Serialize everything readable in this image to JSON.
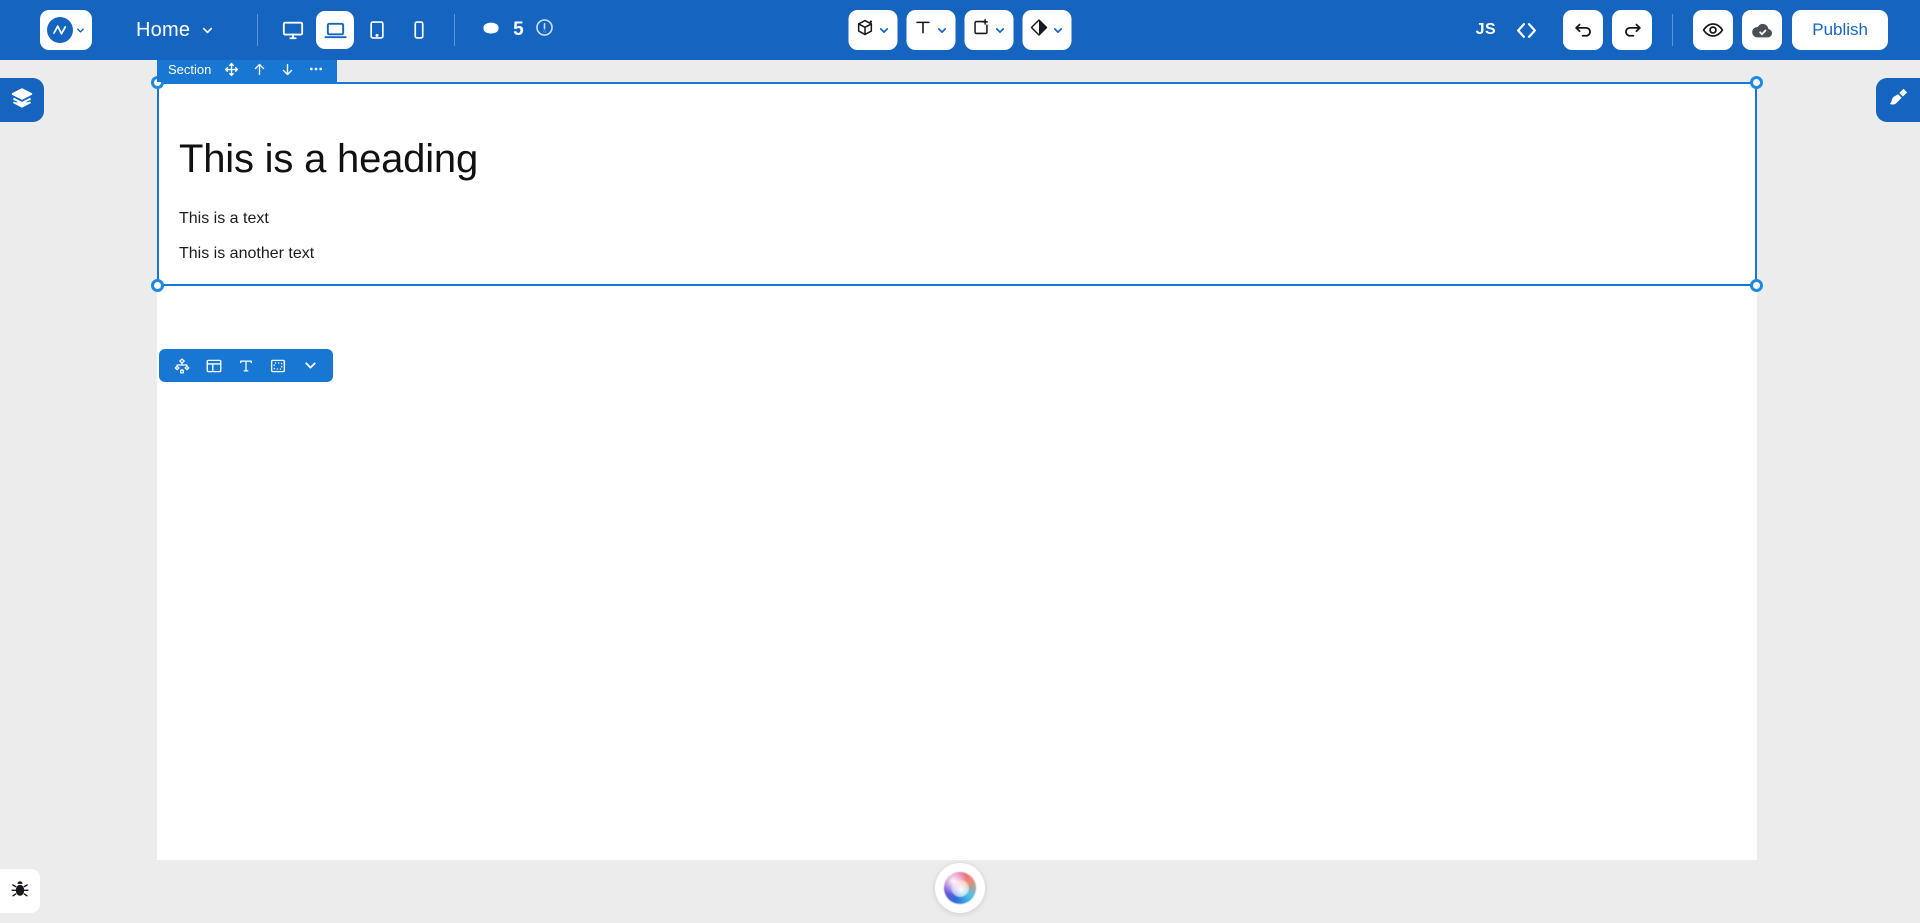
{
  "topbar": {
    "logo_name": "brand-logo",
    "page_selector": {
      "label": "Home"
    },
    "devices": [
      {
        "name": "desktop",
        "active": false
      },
      {
        "name": "laptop",
        "active": true
      },
      {
        "name": "tablet",
        "active": false
      },
      {
        "name": "mobile",
        "active": false
      }
    ],
    "credits": {
      "value": "5"
    },
    "tools": [
      {
        "name": "add-element",
        "icon": "cube-plus-icon"
      },
      {
        "name": "text",
        "icon": "text-t-icon"
      },
      {
        "name": "add-block",
        "icon": "square-plus-icon"
      },
      {
        "name": "theme",
        "icon": "contrast-diamond-icon"
      }
    ],
    "js_label": "JS",
    "code_label": "<>",
    "undo_label": "Undo",
    "redo_label": "Redo",
    "preview_label": "Preview",
    "save_label": "Saved",
    "publish_label": "Publish"
  },
  "side": {
    "left_tab": "Layers",
    "right_tab": "Design",
    "bug_tab": "Report a bug"
  },
  "selection": {
    "tag_label": "Section",
    "actions": [
      {
        "name": "move",
        "icon": "move-arrows-icon"
      },
      {
        "name": "move-up",
        "icon": "arrow-up-icon"
      },
      {
        "name": "move-down",
        "icon": "arrow-down-icon"
      },
      {
        "name": "more",
        "icon": "ellipsis-icon"
      }
    ],
    "element_tools": [
      {
        "name": "structure",
        "icon": "sitemap-icon"
      },
      {
        "name": "layout",
        "icon": "layout-columns-icon"
      },
      {
        "name": "typography",
        "icon": "text-t-icon"
      },
      {
        "name": "spacing",
        "icon": "dashed-box-icon"
      },
      {
        "name": "more-tools",
        "icon": "chevron-down-icon"
      }
    ]
  },
  "canvas": {
    "heading": "This is a heading",
    "paragraph_1": "This is a text",
    "paragraph_2": "This is another text"
  },
  "assistant": {
    "name": "ai-assistant-orb"
  },
  "colors": {
    "brand_blue": "#1565c0",
    "selection_blue": "#1877d2",
    "stage_grey": "#ececec",
    "canvas_white": "#ffffff"
  }
}
